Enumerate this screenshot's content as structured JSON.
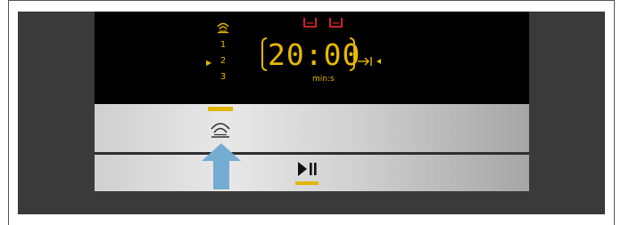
{
  "display": {
    "programs": [
      "1",
      "2",
      "3"
    ],
    "selected_program": "2",
    "timer_value": "20:00",
    "timer_unit": "min:s"
  },
  "icons": {
    "program_icon": "steam-wave-icon",
    "tray_icons": [
      "water-tray-icon",
      "water-tray-icon"
    ],
    "end_time_icon": "end-time-icon",
    "program_button_icon": "steam-wave-icon",
    "start_pause_icon": "play-pause-icon",
    "pointer_icon": "up-arrow-icon"
  },
  "colors": {
    "display_text": "#e7b800",
    "tray_indicator": "#e0262b",
    "led": "#e2b500",
    "arrow": "#74add1"
  }
}
